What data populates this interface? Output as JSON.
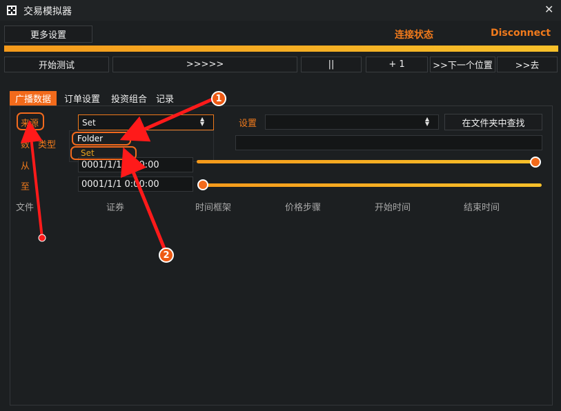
{
  "window": {
    "title": "交易模拟器",
    "close_symbol": "✕"
  },
  "header": {
    "more_settings": "更多设置",
    "connection_label": "连接状态",
    "connection_value": "Disconnect"
  },
  "progress": {
    "value": 1.0
  },
  "controls": {
    "start_test": "开始测试",
    "fast_forward": ">>>>>",
    "pause": "||",
    "plus_one": "+ 1",
    "next_position": ">>下一个位置",
    "go_to": ">>去"
  },
  "tabs": [
    {
      "label": "广播数据",
      "active": true
    },
    {
      "label": "订单设置",
      "active": false
    },
    {
      "label": "投资组合",
      "active": false
    },
    {
      "label": "记录",
      "active": false
    }
  ],
  "form": {
    "source_label": "来源",
    "type_label_visible": "数",
    "type_label_tail": "类型",
    "from_label": "从",
    "to_label": "至",
    "source_value": "Set",
    "dropdown_options": [
      "Folder",
      "Set"
    ],
    "settings_label": "设置",
    "settings_value": "",
    "find_in_folder": "在文件夹中查找",
    "from_date": "0001/1/1 0:00:00",
    "to_date": "0001/1/1 0:00:00",
    "from_slider": 1.0,
    "to_slider": 0.0
  },
  "table": {
    "columns": [
      "文件",
      "证券",
      "时间框架",
      "价格步骤",
      "开始时间",
      "结束时间"
    ]
  },
  "annotations": {
    "badge_1": "1",
    "badge_2": "2"
  },
  "colors": {
    "accent": "#f26a1b",
    "progress": "#f7b928",
    "annotation": "#ff1a1a"
  }
}
